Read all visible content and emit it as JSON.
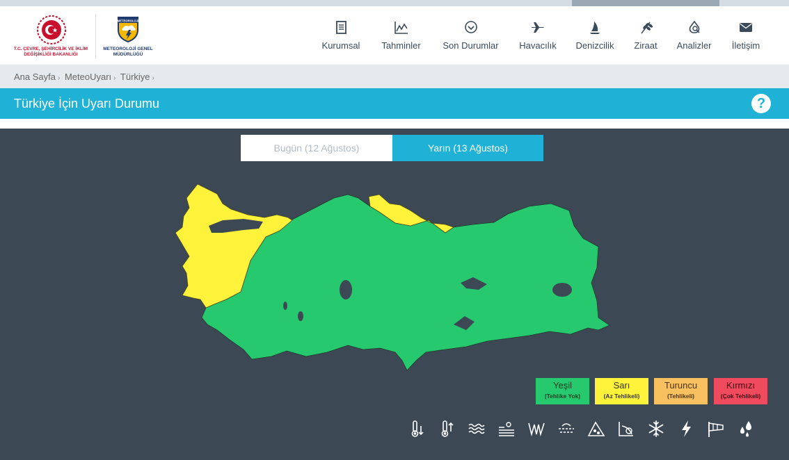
{
  "header": {
    "ministry_logo_text": "T.C. ÇEVRE, ŞEHİRCİLİK VE İKLİM DEĞİŞİKLİĞİ BAKANLIĞI",
    "mgm_logo_badge": "METEOROLOJİ",
    "mgm_logo_text": "METEOROLOJİ GENEL MÜDÜRLÜĞÜ"
  },
  "nav": [
    {
      "label": "Kurumsal",
      "icon": "document-icon"
    },
    {
      "label": "Tahminler",
      "icon": "chart-icon"
    },
    {
      "label": "Son Durumlar",
      "icon": "chevron-circle-icon"
    },
    {
      "label": "Havacılık",
      "icon": "airplane-icon"
    },
    {
      "label": "Denizcilik",
      "icon": "sail-icon"
    },
    {
      "label": "Ziraat",
      "icon": "wheat-icon"
    },
    {
      "label": "Analizler",
      "icon": "analysis-icon"
    },
    {
      "label": "İletişim",
      "icon": "envelope-icon"
    }
  ],
  "breadcrumb": [
    "Ana Sayfa",
    "MeteoUyarı",
    "Türkiye"
  ],
  "page_title": "Türkiye İçin Uyarı Durumu",
  "help_label": "?",
  "tabs": {
    "today": "Bugün (12 Ağustos)",
    "tomorrow": "Yarın (13 Ağustos)",
    "active": "tomorrow"
  },
  "map": {
    "colors": {
      "green": "#27c96f",
      "yellow": "#fff23a"
    },
    "yellow_zone": "west + central Black Sea coast",
    "green_zone": "rest of country"
  },
  "legend": [
    {
      "name": "Yeşil",
      "desc": "(Tehlike Yok)",
      "color": "#27c96f",
      "text_color": "#1a3d22"
    },
    {
      "name": "Sarı",
      "desc": "(Az Tehlikeli)",
      "color": "#fff23a",
      "text_color": "#333333"
    },
    {
      "name": "Turuncu",
      "desc": "(Tehlikeli)",
      "color": "#f9c060",
      "text_color": "#4a3311"
    },
    {
      "name": "Kırmızı",
      "desc": "(Çok Tehlikeli)",
      "color": "#ef4a5e",
      "text_color": "#3d0d14"
    }
  ],
  "hazard_icons": [
    "low-temperature-icon",
    "high-temperature-icon",
    "fog-icon",
    "dust-storm-icon",
    "wind-icon",
    "sandstorm-icon",
    "avalanche-icon",
    "flood-icon",
    "snow-icon",
    "thunderstorm-icon",
    "windsock-icon",
    "rain-icon"
  ]
}
